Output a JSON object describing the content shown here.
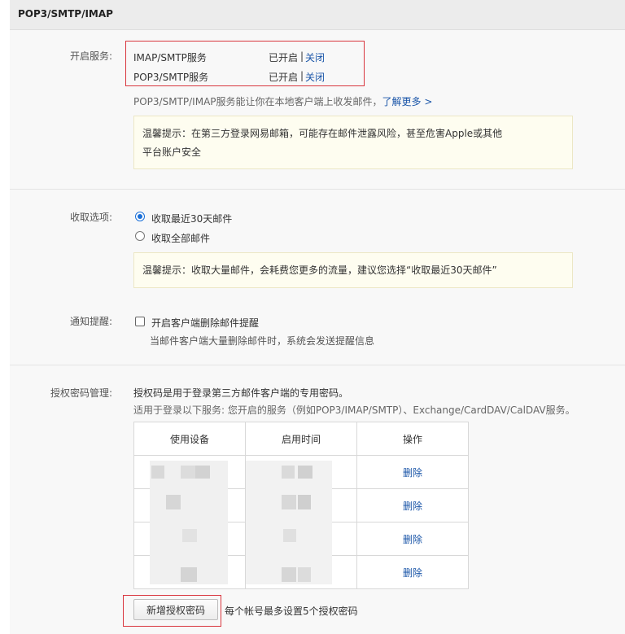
{
  "header": {
    "title": "POP3/SMTP/IMAP"
  },
  "service": {
    "label": "开启服务:",
    "rows": [
      {
        "name": "IMAP/SMTP服务",
        "status": "已开启",
        "sep": "|",
        "action": "关闭"
      },
      {
        "name": "POP3/SMTP服务",
        "status": "已开启",
        "sep": "|",
        "action": "关闭"
      }
    ],
    "desc": "POP3/SMTP/IMAP服务能让你在本地客户端上收发邮件，",
    "learn_more": "了解更多 >",
    "tip_line1": "温馨提示：在第三方登录网易邮箱，可能存在邮件泄露风险，甚至危害Apple或其他",
    "tip_line2": "平台账户安全"
  },
  "receive": {
    "label": "收取选项:",
    "options": [
      "收取最近30天邮件",
      "收取全部邮件"
    ],
    "selected_index": 0,
    "tip": "温馨提示：收取大量邮件，会耗费您更多的流量，建议您选择“收取最近30天邮件”"
  },
  "notify": {
    "label": "通知提醒:",
    "checkbox_label": "开启客户端删除邮件提醒",
    "checked": false,
    "desc": "当邮件客户端大量删除邮件时，系统会发送提醒信息"
  },
  "auth": {
    "label": "授权密码管理:",
    "desc1": "授权码是用于登录第三方邮件客户端的专用密码。",
    "desc2": "适用于登录以下服务: 您开启的服务（例如POP3/IMAP/SMTP）、Exchange/CardDAV/CalDAV服务。",
    "columns": [
      "使用设备",
      "启用时间",
      "操作"
    ],
    "rows": [
      {
        "action": "删除"
      },
      {
        "action": "删除"
      },
      {
        "action": "删除"
      },
      {
        "action": "删除"
      }
    ],
    "add_button": "新增授权密码",
    "limit_note": "每个帐号最多设置5个授权密码"
  },
  "colors": {
    "link": "#1a55a8",
    "highlight_border": "#d9363e",
    "radio": "#1a6fd8",
    "tip_bg": "#fefdf0"
  }
}
